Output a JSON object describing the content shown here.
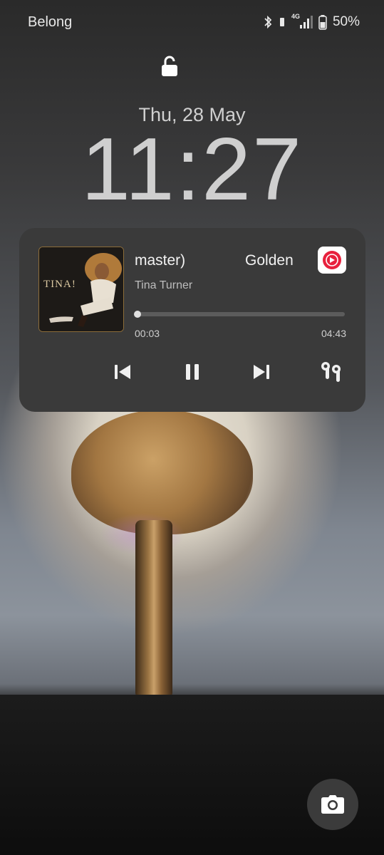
{
  "status_bar": {
    "carrier": "Belong",
    "network": "4G",
    "battery_percent": "50%"
  },
  "lockscreen": {
    "date": "Thu, 28 May",
    "time": "11:27"
  },
  "media": {
    "title_visible": "master)",
    "title_next": "Golden",
    "artist": "Tina Turner",
    "album_art_text": "TINA!",
    "elapsed": "00:03",
    "duration": "04:43",
    "progress_fraction": 0.011,
    "app": "youtube-music-icon"
  },
  "colors": {
    "card_bg": "#3a3a3a",
    "app_red": "#e8213d"
  }
}
